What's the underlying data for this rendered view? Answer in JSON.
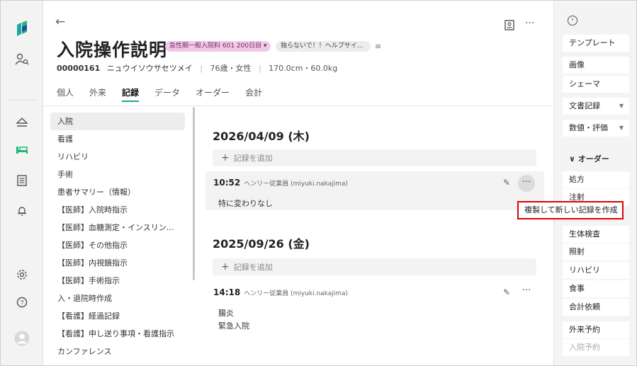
{
  "header": {
    "title": "入院操作説明",
    "badge_ward": "急性期一般入院料 601 200日目 ▾",
    "badge_note": "独らないで！！ヘルプサイ…",
    "patient_id": "00000161",
    "patient_kana": "ニュウイソウサセツメイ",
    "age_sex": "76歳・女性",
    "body": "170.0cm・60.0kg"
  },
  "tabs": [
    {
      "label": "個人"
    },
    {
      "label": "外来"
    },
    {
      "label": "記録"
    },
    {
      "label": "データ"
    },
    {
      "label": "オーダー"
    },
    {
      "label": "会計"
    }
  ],
  "categories": [
    "入院",
    "看護",
    "リハビリ",
    "手術",
    "患者サマリー（情報）",
    "【医師】入院時指示",
    "【医師】血糖測定・インスリン…",
    "【医師】その他指示",
    "【医師】内視鏡指示",
    "【医師】手術指示",
    "入・退院時作成",
    "【看護】経過記録",
    "【看護】申し送り事項・看護指示",
    "カンファレンス"
  ],
  "records": {
    "add_label": "記録を追加",
    "groups": [
      {
        "date": "2026/04/09 (木)",
        "entry": {
          "time": "10:52",
          "author": "ヘンリー従業員 (miyuki.nakajima)",
          "lines": [
            "特に変わりなし"
          ]
        }
      },
      {
        "date": "2025/09/26 (金)",
        "entry": {
          "time": "14:18",
          "author": "ヘンリー従業員 (miyuki.nakajima)",
          "lines": [
            "腸炎",
            "緊急入院"
          ]
        }
      }
    ]
  },
  "popup": {
    "label": "複製して新しい記録を作成"
  },
  "right_panel": {
    "items_top": [
      "テンプレート",
      "画像",
      "シェーマ",
      "文書記録",
      "数値・評価"
    ],
    "order_heading": "∨ オーダー",
    "orders": [
      "処方",
      "注射",
      "生体検査",
      "照射",
      "リハビリ",
      "食事",
      "会計依頼",
      "外来予約",
      "入院予約"
    ]
  },
  "colors": {
    "accent": "#17a99b",
    "badge_pink": "#f2c8e8",
    "highlight_red": "#e00000"
  }
}
